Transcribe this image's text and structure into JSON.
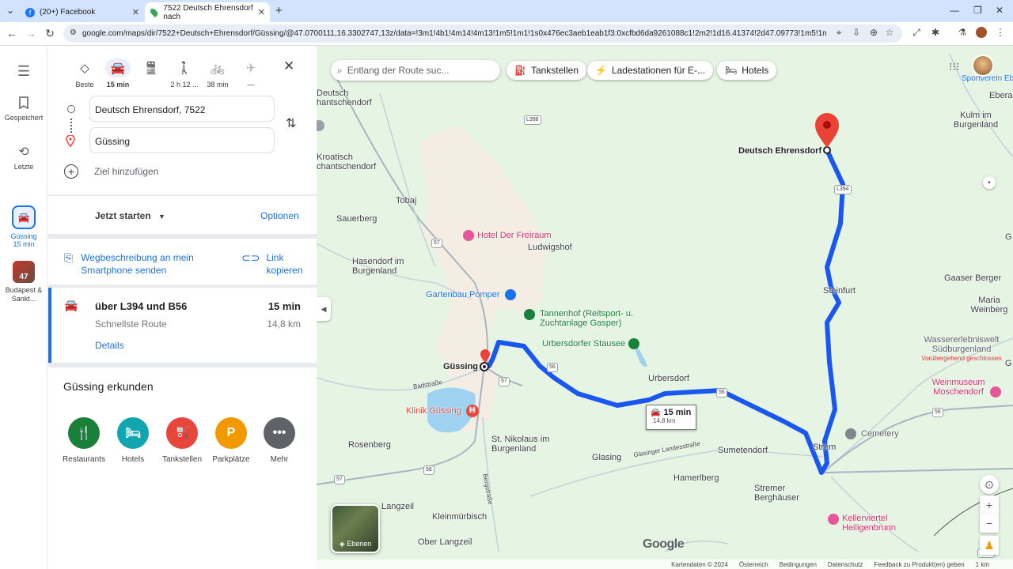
{
  "browser": {
    "tabs": [
      {
        "title": "(20+) Facebook",
        "icon": "facebook-icon"
      },
      {
        "title": "7522 Deutsch Ehrensdorf nach",
        "icon": "maps-pin-icon"
      }
    ],
    "url": "google.com/maps/dir/7522+Deutsch+Ehrensdorf/Güssing/@47.0700111,16.3302747,13z/data=!3m1!4b1!4m14!4m13!1m5!1m1!1s0x476ec3aeb1eab1f3:0xcfbd6da9261088c1!2m2!1d16.41374!2d47.09773!1m5!1m1!1s0x476edd5..."
  },
  "rail": {
    "menu_icon": "menu-icon",
    "saved_label": "Gespeichert",
    "recent_label": "Letzte",
    "recent_item_label": "Güssing",
    "recent_item_time": "15 min",
    "trip_badge": "47",
    "trip_label": "Budapest & Sankt..."
  },
  "directions": {
    "modes": [
      {
        "label": "Beste",
        "icon": "diamond-route-icon",
        "active": false
      },
      {
        "label": "15 min",
        "icon": "car-icon",
        "active": true
      },
      {
        "label": "",
        "icon": "transit-icon",
        "active": false
      },
      {
        "label": "2 h 12 ...",
        "icon": "walk-icon",
        "active": false
      },
      {
        "label": "38 min",
        "icon": "bike-icon",
        "active": false
      },
      {
        "label": "—",
        "icon": "flight-icon",
        "active": false
      }
    ],
    "origin": "Deutsch Ehrensdorf, 7522",
    "destination": "Güssing",
    "add_destination": "Ziel hinzufügen",
    "depart_label": "Jetzt starten",
    "options_label": "Optionen",
    "send_to_phone": "Wegbeschreibung an mein Smartphone senden",
    "copy_link": "Link kopieren",
    "route": {
      "via": "über L394 und B56",
      "duration": "15 min",
      "subtitle": "Schnellste Route",
      "distance": "14,8 km",
      "details": "Details"
    },
    "explore_title": "Güssing erkunden",
    "categories": [
      {
        "label": "Restaurants",
        "color": "#188038",
        "icon": "restaurant-icon"
      },
      {
        "label": "Hotels",
        "color": "#12a4af",
        "icon": "hotel-icon"
      },
      {
        "label": "Tankstellen",
        "color": "#e8453c",
        "icon": "gas-station-icon"
      },
      {
        "label": "Parkplätze",
        "color": "#f29900",
        "icon": "parking-icon"
      },
      {
        "label": "Mehr",
        "color": "#5f6368",
        "icon": "more-icon"
      }
    ]
  },
  "map": {
    "search_placeholder": "Entlang der Route suc...",
    "chips": [
      "Tankstellen",
      "Ladestationen für E-...",
      "Hotels"
    ],
    "route_color": "#1a56f0",
    "route_bubble_time": "15 min",
    "route_bubble_dist": "14,8 km",
    "layers_label": "Ebenen",
    "google_logo": "Google",
    "places": {
      "deutsch_ehrensdorf": "Deutsch Ehrensdorf",
      "guessing": "Güssing",
      "ludwigshof": "Ludwigshof",
      "tobaj": "Tobaj",
      "sauerberg": "Sauerberg",
      "hasendorf": "Hasendorf im Burgenland",
      "kroatisch": "Kroatisch chantschendorf",
      "deutsch_tsch": "Deutsch hantschendorf",
      "steinfurt": "Steinfurt",
      "urbersdorf": "Urbersdorf",
      "strem": "Strem",
      "sumetendorf": "Sumetendorf",
      "glasing": "Glasing",
      "hamerlberg": "Hamerlberg",
      "stremer_berghaeuser": "Stremer Berghäuser",
      "rosenberg": "Rosenberg",
      "st_nikolaus": "St. Nikolaus im Burgenland",
      "langzeil": "Langzeil",
      "kleinmuerbisch": "Kleinmürbisch",
      "ober_langzeil": "Ober Langzeil",
      "kulm": "Kulm im Burgenland",
      "gaaser_berger": "Gaaser Berger",
      "maria_weinberg": "Maria Weinberg",
      "ebera": "Ebera",
      "sportverein": "Sportverein Ebe",
      "g_right": "G",
      "hotel_freiraum": "Hotel Der Freiraum",
      "gartenbau": "Gartenbau Pomper",
      "tannenhof": "Tannenhof (Reitsport- u. Zuchtanlage Gasper)",
      "urbersdorfer_stausee": "Urbersdorfer Stausee",
      "klinik": "Klinik Güssing",
      "cemetery": "Cemetery",
      "wassererlebnis": "Wassererlebniswelt Südburgenland",
      "wassererlebnis_sub": "Vorübergehend geschlossen",
      "weinmuseum": "Weinmuseum Moschendorf",
      "kellerviertel": "Kellerviertel Heiligenbrunn",
      "badstrasse": "Badstraße",
      "bergstrasse": "Bergstraße",
      "glasinger_landesstrasse": "Glasinger Landesstraße"
    },
    "road_shields": [
      "L398",
      "L394",
      "57",
      "56",
      "57",
      "56",
      "57",
      "56",
      "56",
      "L249"
    ],
    "footer": [
      "Kartendaten © 2024",
      "Österreich",
      "Bedingungen",
      "Datenschutz",
      "Feedback zu Produkt(en) geben",
      "1 km"
    ]
  }
}
